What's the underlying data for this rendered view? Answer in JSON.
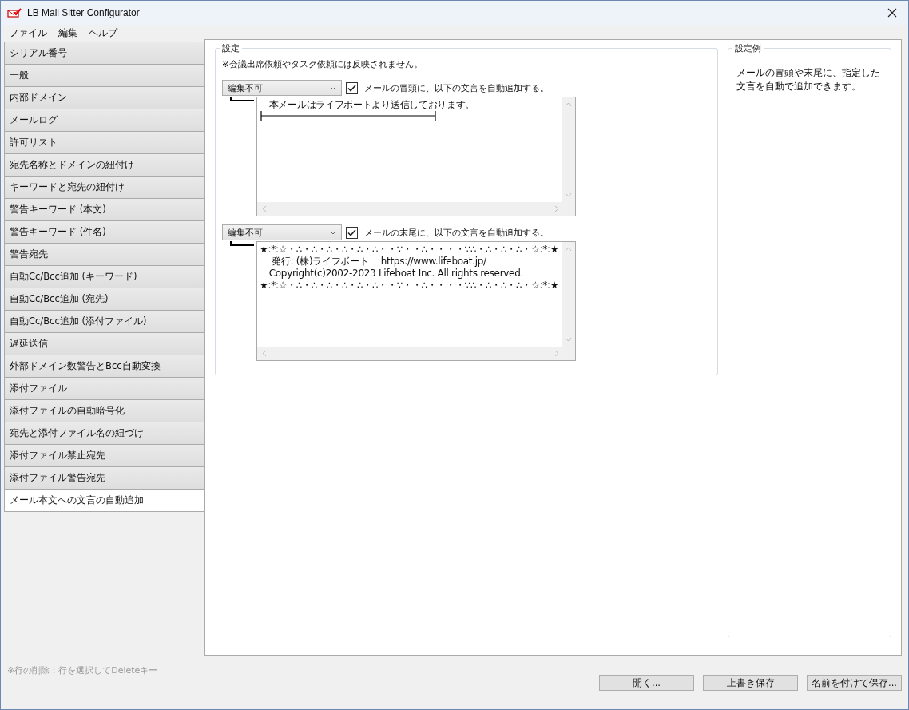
{
  "window": {
    "title": "LB Mail Sitter Configurator"
  },
  "menu": [
    "ファイル",
    "編集",
    "ヘルプ"
  ],
  "sidebar": {
    "items": [
      {
        "label": "シリアル番号",
        "selected": false
      },
      {
        "label": "一般",
        "selected": false
      },
      {
        "label": "内部ドメイン",
        "selected": false
      },
      {
        "label": "メールログ",
        "selected": false
      },
      {
        "label": "許可リスト",
        "selected": false
      },
      {
        "label": "宛先名称とドメインの紐付け",
        "selected": false
      },
      {
        "label": "キーワードと宛先の紐付け",
        "selected": false
      },
      {
        "label": "警告キーワード (本文)",
        "selected": false
      },
      {
        "label": "警告キーワード (件名)",
        "selected": false
      },
      {
        "label": "警告宛先",
        "selected": false
      },
      {
        "label": "自動Cc/Bcc追加 (キーワード)",
        "selected": false
      },
      {
        "label": "自動Cc/Bcc追加 (宛先)",
        "selected": false
      },
      {
        "label": "自動Cc/Bcc追加 (添付ファイル)",
        "selected": false
      },
      {
        "label": "遅延送信",
        "selected": false
      },
      {
        "label": "外部ドメイン数警告とBcc自動変換",
        "selected": false
      },
      {
        "label": "添付ファイル",
        "selected": false
      },
      {
        "label": "添付ファイルの自動暗号化",
        "selected": false
      },
      {
        "label": "宛先と添付ファイル名の紐づけ",
        "selected": false
      },
      {
        "label": "添付ファイル禁止宛先",
        "selected": false
      },
      {
        "label": "添付ファイル警告宛先",
        "selected": false
      },
      {
        "label": "メール本文への文言の自動追加",
        "selected": true
      }
    ]
  },
  "settings": {
    "title": "設定",
    "note": "※会議出席依頼やタスク依頼には反映されません。",
    "blocks": [
      {
        "mode": "編集不可",
        "checked": true,
        "label": "メールの冒頭に、以下の文言を自動追加する。",
        "lines": [
          {
            "kind": "text",
            "text": "　本メールはライフボートより送信しております。"
          },
          {
            "kind": "rule"
          }
        ]
      },
      {
        "mode": "編集不可",
        "checked": true,
        "label": "メールの末尾に、以下の文言を自動追加する。",
        "lines": [
          {
            "kind": "text",
            "text": "★:*:☆・∴・∴・∴・∴・∴・∴・・∵・・∴・・・・∵∴・∴・∴・∴・☆:*:★"
          },
          {
            "kind": "text",
            "text": "　 発行: (株)ライフボート　 https://www.lifeboat.jp/"
          },
          {
            "kind": "text",
            "text": "　Copyright(c)2002-2023  Lifeboat Inc. All rights reserved."
          },
          {
            "kind": "text",
            "text": "★:*:☆・∴・∴・∴・∴・∴・∴・・∵・・∴・・・・∵∴・∴・∴・∴・☆:*:★"
          }
        ]
      }
    ]
  },
  "example": {
    "title": "設定例",
    "text": "メールの冒頭や末尾に、指定した文言を自動で追加できます。"
  },
  "hint": "※行の削除：行を選択してDeleteキー",
  "buttons": [
    "開く...",
    "上書き保存",
    "名前を付けて保存..."
  ]
}
